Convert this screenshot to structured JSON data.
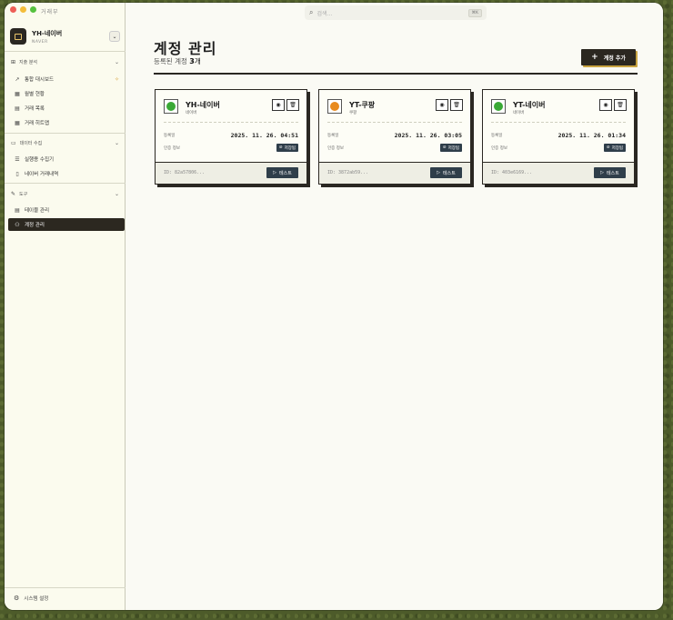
{
  "app": {
    "title": "거래부"
  },
  "account": {
    "name": "YH-네이버",
    "platform": "NAVER",
    "toggle_icon": "chevron-updown-icon"
  },
  "sidebar": {
    "sections": [
      {
        "label": "지출 분석",
        "icon": "chart-icon",
        "items": [
          {
            "label": "통합 대시보드",
            "icon": "trend-icon",
            "badge": "sparkle-icon"
          },
          {
            "label": "월별 현황",
            "icon": "calendar-icon"
          },
          {
            "label": "거래 목록",
            "icon": "document-icon"
          },
          {
            "label": "거래 히트맵",
            "icon": "grid-icon"
          }
        ]
      },
      {
        "label": "데이터 수집",
        "icon": "folder-icon",
        "items": [
          {
            "label": "실행용 수집기",
            "icon": "database-icon"
          },
          {
            "label": "네이버 거래내역",
            "icon": "file-icon"
          }
        ]
      },
      {
        "label": "도구",
        "icon": "wrench-icon",
        "items": [
          {
            "label": "테이블 관리",
            "icon": "table-icon"
          },
          {
            "label": "계정 관리",
            "icon": "users-icon",
            "active": true
          }
        ]
      }
    ],
    "system_settings": "시스템 설정"
  },
  "search": {
    "placeholder": "검색...",
    "shortcut": "⌘K"
  },
  "page": {
    "title": "계정 관리",
    "count_prefix": "등록된 계정",
    "count": "3",
    "count_unit": "개",
    "add_button": "계정 추가"
  },
  "labels": {
    "registered": "등록일",
    "auth": "인증 정보",
    "saved": "저장됨",
    "test": "테스트"
  },
  "accounts": [
    {
      "name": "YH-네이버",
      "platform": "네이버",
      "date": "2025. 11. 26. 04:51",
      "id": "ID: 82a57806...",
      "status_color": "#3aa936"
    },
    {
      "name": "YT-쿠팡",
      "platform": "쿠팡",
      "date": "2025. 11. 26. 03:05",
      "id": "ID: 3872ab59...",
      "status_color": "#e88a1f"
    },
    {
      "name": "YT-네이버",
      "platform": "네이버",
      "date": "2025. 11. 26. 01:34",
      "id": "ID: 403e6169...",
      "status_color": "#3aa936"
    }
  ]
}
